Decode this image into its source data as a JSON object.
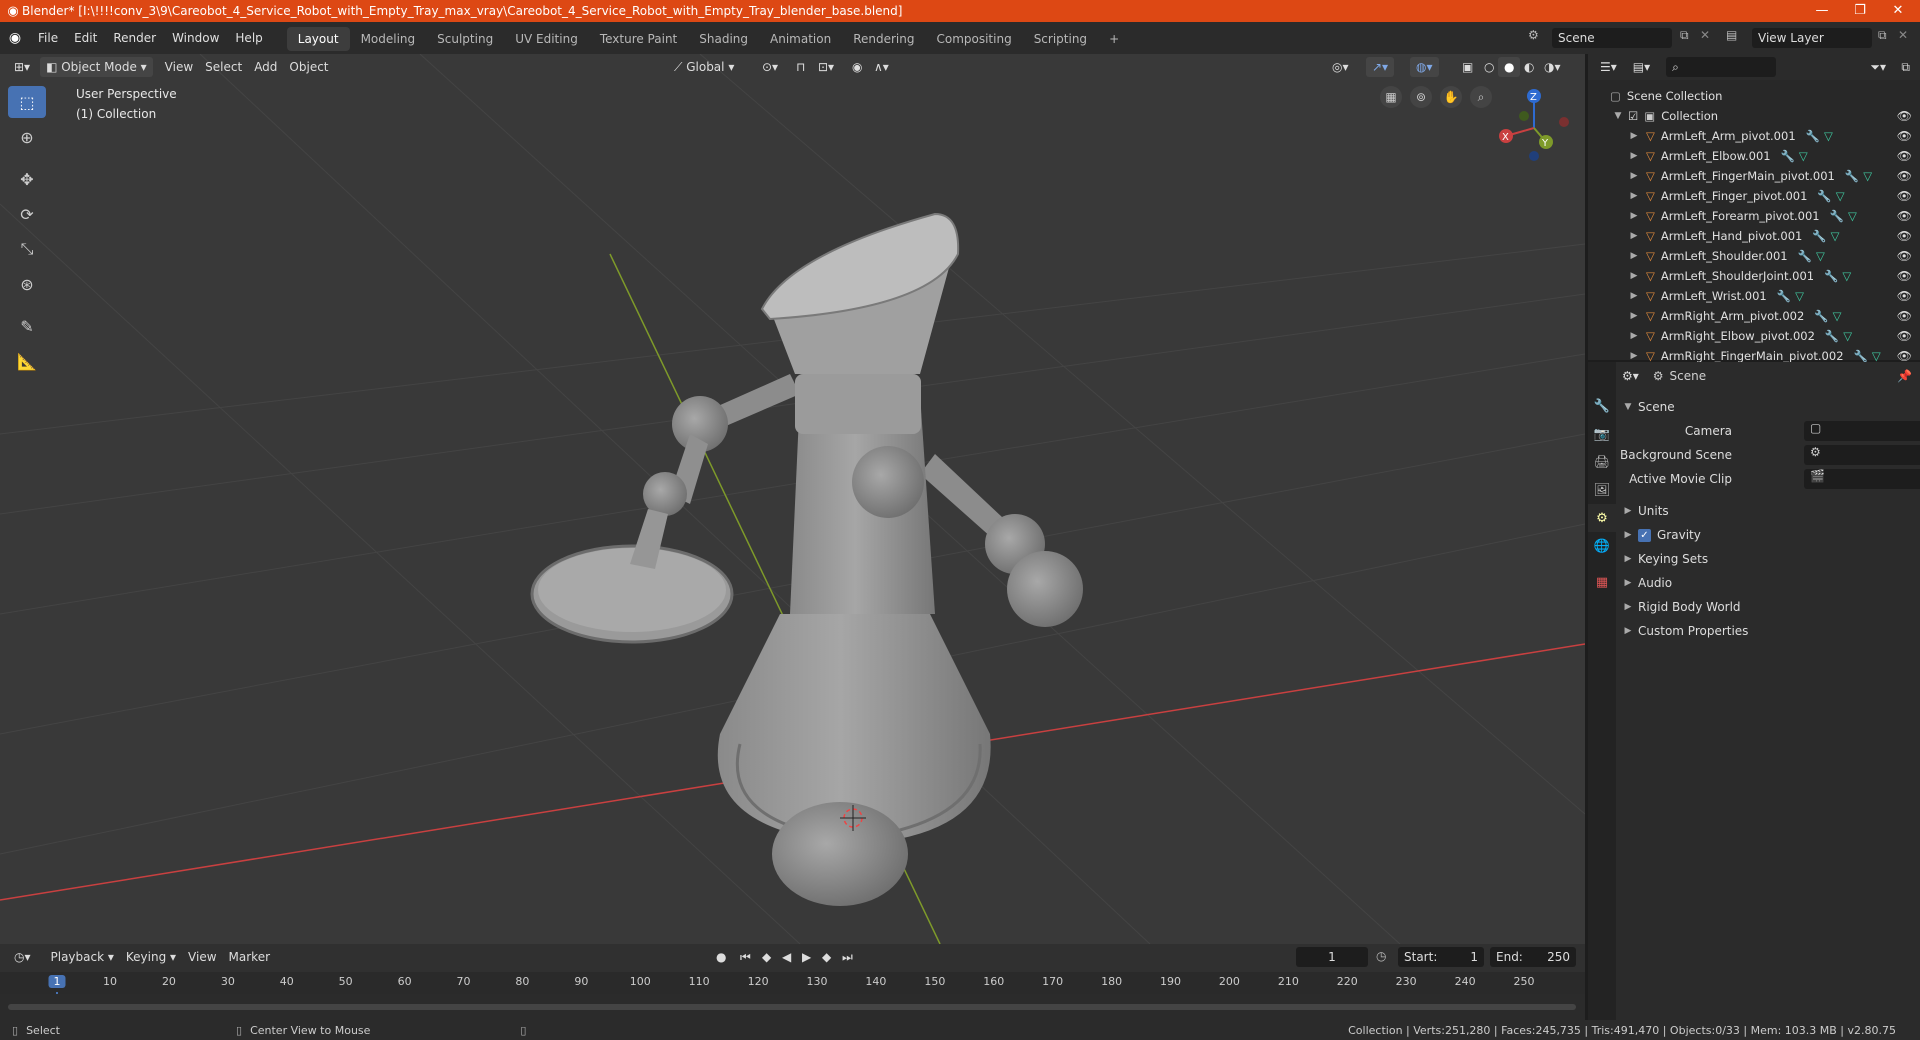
{
  "titlebar": {
    "title": "Blender* [I:\\!!!!conv_3\\9\\Careobot_4_Service_Robot_with_Empty_Tray_max_vray\\Careobot_4_Service_Robot_with_Empty_Tray_blender_base.blend]",
    "min": "—",
    "max": "❐",
    "close": "✕"
  },
  "menu": [
    "File",
    "Edit",
    "Render",
    "Window",
    "Help"
  ],
  "workspaces": [
    "Layout",
    "Modeling",
    "Sculpting",
    "UV Editing",
    "Texture Paint",
    "Shading",
    "Animation",
    "Rendering",
    "Compositing",
    "Scripting"
  ],
  "active_workspace": "Layout",
  "scene_field": "Scene",
  "view_layer_field": "View Layer",
  "viewport_header": {
    "mode": "Object Mode",
    "menus": [
      "View",
      "Select",
      "Add",
      "Object"
    ],
    "transform": "Global"
  },
  "overlay": {
    "line1": "User Perspective",
    "line2": "(1) Collection"
  },
  "gizmo": {
    "x": "X",
    "y": "Y",
    "z": "Z"
  },
  "outliner": {
    "root": "Scene Collection",
    "collection": "Collection",
    "items": [
      "ArmLeft_Arm_pivot.001",
      "ArmLeft_Elbow.001",
      "ArmLeft_FingerMain_pivot.001",
      "ArmLeft_Finger_pivot.001",
      "ArmLeft_Forearm_pivot.001",
      "ArmLeft_Hand_pivot.001",
      "ArmLeft_Shoulder.001",
      "ArmLeft_ShoulderJoint.001",
      "ArmLeft_Wrist.001",
      "ArmRight_Arm_pivot.002",
      "ArmRight_Elbow_pivot.002",
      "ArmRight_FingerMain_pivot.002"
    ]
  },
  "properties": {
    "header": "Scene",
    "panel": "Scene",
    "camera_label": "Camera",
    "background_label": "Background Scene",
    "movieclip_label": "Active Movie Clip",
    "subpanels": [
      "Units",
      "Gravity",
      "Keying Sets",
      "Audio",
      "Rigid Body World",
      "Custom Properties"
    ],
    "gravity_checked": true
  },
  "timeline": {
    "menus": [
      "Playback",
      "Keying",
      "View",
      "Marker"
    ],
    "current_frame": "1",
    "start_label": "Start:",
    "start": "1",
    "end_label": "End:",
    "end": "250",
    "ticks": [
      "1",
      "10",
      "20",
      "30",
      "40",
      "50",
      "60",
      "70",
      "80",
      "90",
      "100",
      "110",
      "120",
      "130",
      "140",
      "150",
      "160",
      "170",
      "180",
      "190",
      "200",
      "210",
      "220",
      "230",
      "240",
      "250"
    ]
  },
  "statusbar": {
    "select": "Select",
    "center": "Center View to Mouse",
    "stats": "Collection | Verts:251,280 | Faces:245,735 | Tris:491,470 | Objects:0/33 | Mem: 103.3 MB | v2.80.75"
  },
  "colors": {
    "titlebar": "#dd4814",
    "accent": "#4772b3",
    "viewport_bg": "#393939",
    "x_axis": "#c94040",
    "y_axis": "#7e9a2a"
  }
}
